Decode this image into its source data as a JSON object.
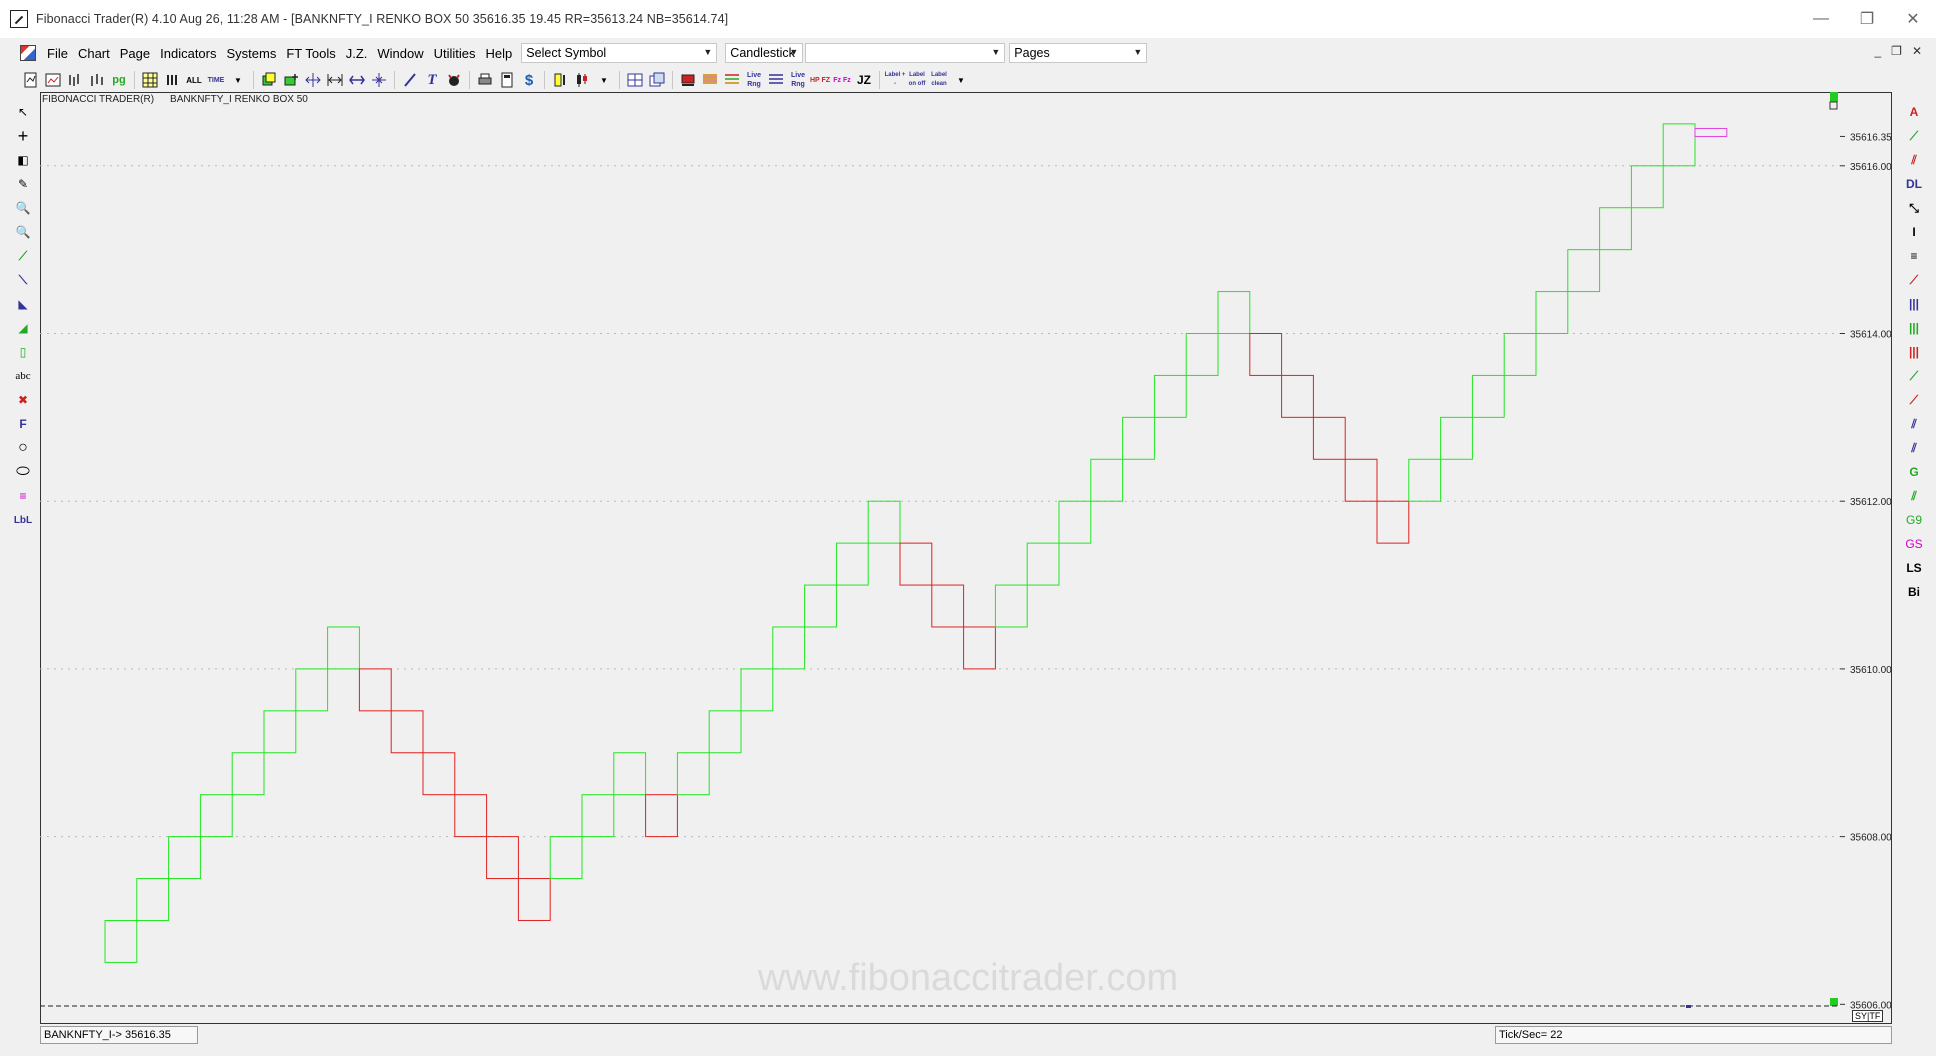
{
  "window": {
    "title": "Fibonacci Trader(R) 4.10 Aug 26,  11:28 AM - [BANKNFTY_I RENKO BOX 50 35616.35      19.45 RR=35613.24 NB=35614.74]",
    "controls": [
      "—",
      "❐",
      "✕"
    ]
  },
  "menu": {
    "items": [
      "File",
      "Chart",
      "Page",
      "Indicators",
      "Systems",
      "FT Tools",
      "J.Z.",
      "Window",
      "Utilities",
      "Help"
    ],
    "symbol_select": "Select Symbol",
    "chart_style": "Candlestick",
    "blank_select": "",
    "pages_select": "Pages",
    "mdi_controls": [
      "_",
      "❐",
      "✕"
    ]
  },
  "toolbar": {
    "text_buttons": [
      "ALL",
      "TIME",
      "Live Rng",
      "Live Rng",
      "HP FZ",
      "Fz Fz",
      "JZ",
      "Label + -",
      "Label on off",
      "Label clean"
    ]
  },
  "lefttools": [
    "↖",
    "+",
    "◧",
    "✎",
    "🔍",
    "🔍",
    "⟋",
    "⟍",
    "◣",
    "◢",
    "▯",
    "abc",
    "✖",
    "F",
    "○",
    "⬭",
    "≡",
    "LbL"
  ],
  "righttools": [
    "A",
    "⟋",
    "⫽",
    "DL",
    "⤡",
    "I",
    "≡",
    "⟋",
    "|||",
    "|||",
    "|||",
    "⟋",
    "⟋",
    "⫽",
    "⫽",
    "G",
    "⫽",
    "G9",
    "GS",
    "LS",
    "Bi"
  ],
  "chart_header": {
    "label1": "FIBONACCI TRADER(R)",
    "label2": "BANKNFTY_I RENKO BOX 50"
  },
  "chart_data": {
    "type": "renko",
    "box_size": 50,
    "watermark": "www.fibonaccitrader.com",
    "y_ticks": [
      35616.0,
      35614.0,
      35612.0,
      35610.0,
      35608.0,
      35606.0
    ],
    "y_tick_labels": [
      "35616.00",
      "35614.00",
      "35612.00",
      "35610.00",
      "35608.00",
      "35606.00"
    ],
    "ylim": [
      35605.98,
      35616.88
    ],
    "last_price_label": "35616.35",
    "last_price": 35616.35,
    "brick_height": 0.5,
    "bricks_bottom": [
      35606.5,
      35607.0,
      35607.5,
      35608.0,
      35608.5,
      35609.0,
      35609.5,
      35610.0,
      35609.5,
      35609.0,
      35608.5,
      35608.0,
      35607.5,
      35607.0,
      35607.5,
      35608.0,
      35608.5,
      35608.0,
      35608.5,
      35609.0,
      35609.5,
      35610.0,
      35610.5,
      35611.0,
      35611.5,
      35611.0,
      35610.5,
      35610.0,
      35610.5,
      35611.0,
      35611.5,
      35612.0,
      35612.5,
      35613.0,
      35613.5,
      35614.0,
      35613.5,
      35613.0,
      35612.5,
      35612.0,
      35611.5,
      35612.0,
      35612.5,
      35613.0,
      35613.5,
      35614.0,
      35614.5,
      35615.0,
      35615.5,
      35616.0
    ],
    "bricks_dir": [
      "up",
      "up",
      "up",
      "up",
      "up",
      "up",
      "up",
      "up",
      "down",
      "down",
      "down",
      "down",
      "down",
      "down",
      "up",
      "up",
      "up",
      "down",
      "up",
      "up",
      "up",
      "up",
      "up",
      "up",
      "up",
      "down",
      "down",
      "down",
      "up",
      "up",
      "up",
      "up",
      "up",
      "up",
      "up",
      "up",
      "down",
      "down",
      "down",
      "down",
      "down",
      "up",
      "up",
      "up",
      "up",
      "up",
      "up",
      "up",
      "up",
      "up"
    ],
    "pending_brick_bottom": 35616.35,
    "colors": {
      "up": "#22e622",
      "down": "#e02020",
      "pending": "#e040e0",
      "grid": "#b8b8b8"
    }
  },
  "status": {
    "left": "BANKNFTY_I->  35616.35",
    "right": "Tick/Sec=  22",
    "corner": "SY|TF"
  }
}
